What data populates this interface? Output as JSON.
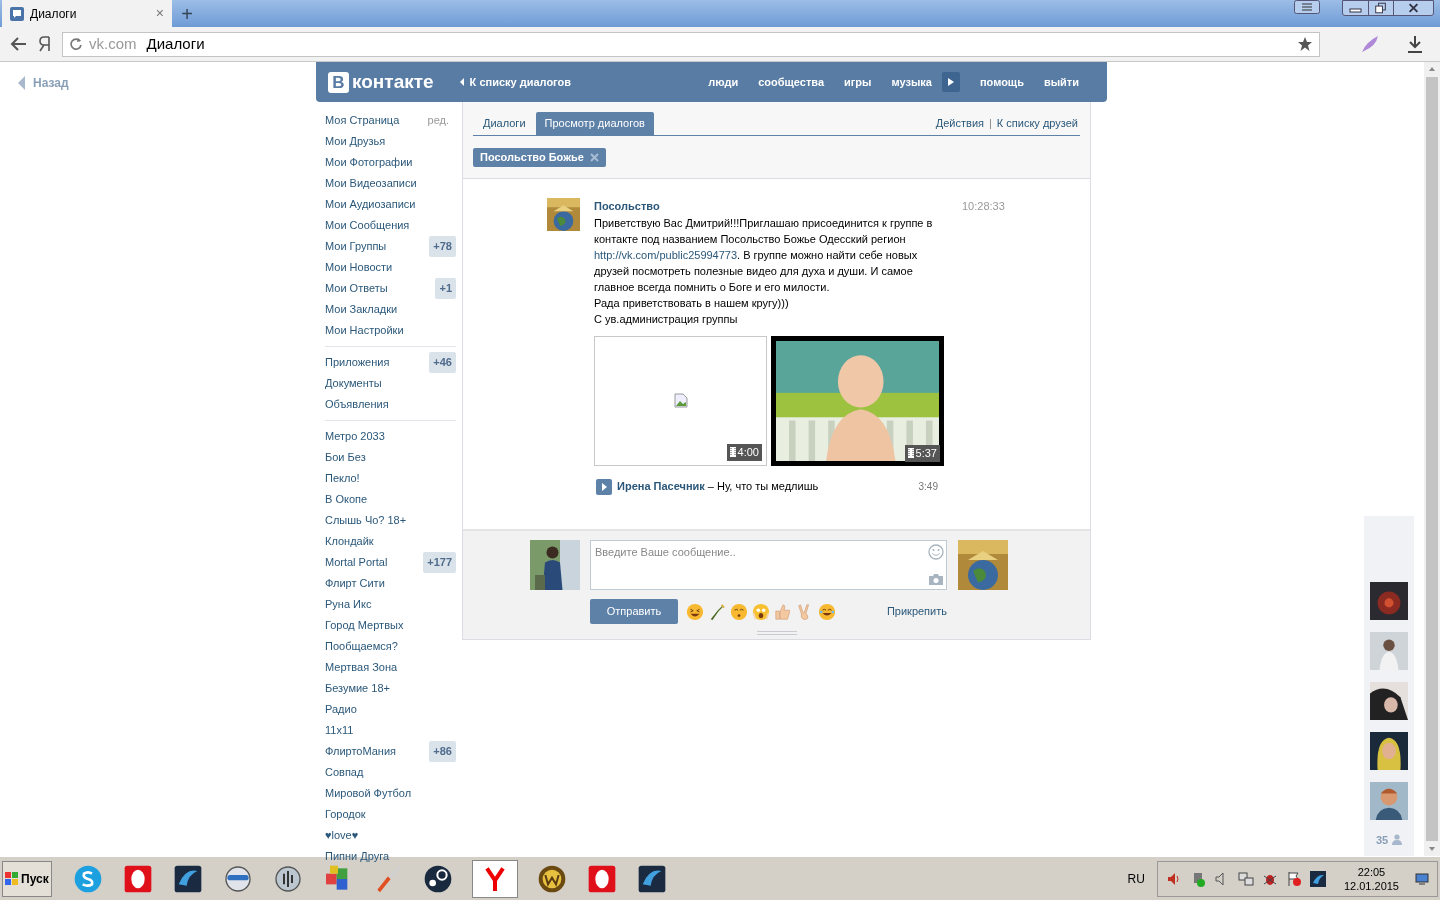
{
  "browser": {
    "tab": {
      "title": "Диалоги",
      "close": "×"
    },
    "new_tab": "+",
    "address": {
      "domain": "vk.com",
      "path": "Диалоги"
    }
  },
  "back_link": "Назад",
  "header": {
    "logo_letter": "В",
    "logo_text": "контакте",
    "back_to_list": "К списку диалогов",
    "nav": [
      "люди",
      "сообщества",
      "игры",
      "музыка",
      "помощь",
      "выйти"
    ]
  },
  "sidebar": {
    "edit": "ред.",
    "groups": [
      [
        {
          "label": "Моя Страница"
        },
        {
          "label": "Мои Друзья"
        },
        {
          "label": "Мои Фотографии"
        },
        {
          "label": "Мои Видеозаписи"
        },
        {
          "label": "Мои Аудиозаписи"
        },
        {
          "label": "Мои Сообщения"
        },
        {
          "label": "Мои Группы",
          "badge": "+78"
        },
        {
          "label": "Мои Новости"
        },
        {
          "label": "Мои Ответы",
          "badge": "+1"
        },
        {
          "label": "Мои Закладки"
        },
        {
          "label": "Мои Настройки"
        }
      ],
      [
        {
          "label": "Приложения",
          "badge": "+46"
        },
        {
          "label": "Документы"
        },
        {
          "label": "Объявления"
        }
      ],
      [
        {
          "label": "Метро 2033"
        },
        {
          "label": "Бои Без"
        },
        {
          "label": "Пекло!"
        },
        {
          "label": "В Окопе"
        },
        {
          "label": "Слышь Чо? 18+"
        },
        {
          "label": "Клондайк"
        },
        {
          "label": "Mortal Portal",
          "badge": "+177"
        },
        {
          "label": "Флирт Сити"
        },
        {
          "label": "Руна Икс"
        },
        {
          "label": "Город Мертвых"
        },
        {
          "label": "Пообщаемся?"
        },
        {
          "label": "Мертвая Зона"
        },
        {
          "label": "Безумие 18+"
        },
        {
          "label": "Радио"
        },
        {
          "label": "11x11"
        },
        {
          "label": "ФлиртоМания",
          "badge": "+86"
        },
        {
          "label": "Совпад"
        },
        {
          "label": "Мировой Футбол"
        },
        {
          "label": "Городок"
        },
        {
          "label": "♥love♥"
        },
        {
          "label": "Пипни Друга"
        }
      ]
    ]
  },
  "tabs": [
    {
      "label": "Диалоги",
      "selected": false
    },
    {
      "label": "Просмотр диалогов",
      "selected": true
    }
  ],
  "tab_links": [
    "Действия",
    "К списку друзей"
  ],
  "tab_links_separator": "|",
  "chip": {
    "label": "Посольство Божье"
  },
  "message": {
    "author": "Посольство",
    "time": "10:28:33",
    "paragraphs": [
      [
        {
          "kind": "text",
          "text": "Приветствую Вас Дмитрий!!!Приглашаю присоединится к группе в контакте под названием Посольство Божье Одесский регион "
        },
        {
          "kind": "link",
          "text": "http://vk.com/public25994773"
        },
        {
          "kind": "text",
          "text": ". В группе можно найти себе новых друзей посмотреть полезные видео для духа и души. И самое главное всегда помнить о Боге и его милости."
        }
      ],
      [
        {
          "kind": "text",
          "text": "Рада приветствовать в нашем кругу)))"
        }
      ],
      [
        {
          "kind": "text",
          "text": "С ув.администрация группы"
        }
      ]
    ],
    "videos": [
      {
        "kind": "broken",
        "duration": "4:00"
      },
      {
        "kind": "picture",
        "duration": "5:37"
      }
    ],
    "audio": {
      "artist": "Ирена Пасечник",
      "separator": "–",
      "title": "Ну, что ты медлишь",
      "duration": "3:49"
    }
  },
  "composer": {
    "placeholder": "Введите Ваше сообщение..",
    "send": "Отправить",
    "attach": "Прикрепить"
  },
  "friends_panel": {
    "count": "35"
  },
  "taskbar": {
    "start": "Пуск",
    "language": "RU",
    "time": "22:05",
    "date": "12.01.2015"
  }
}
